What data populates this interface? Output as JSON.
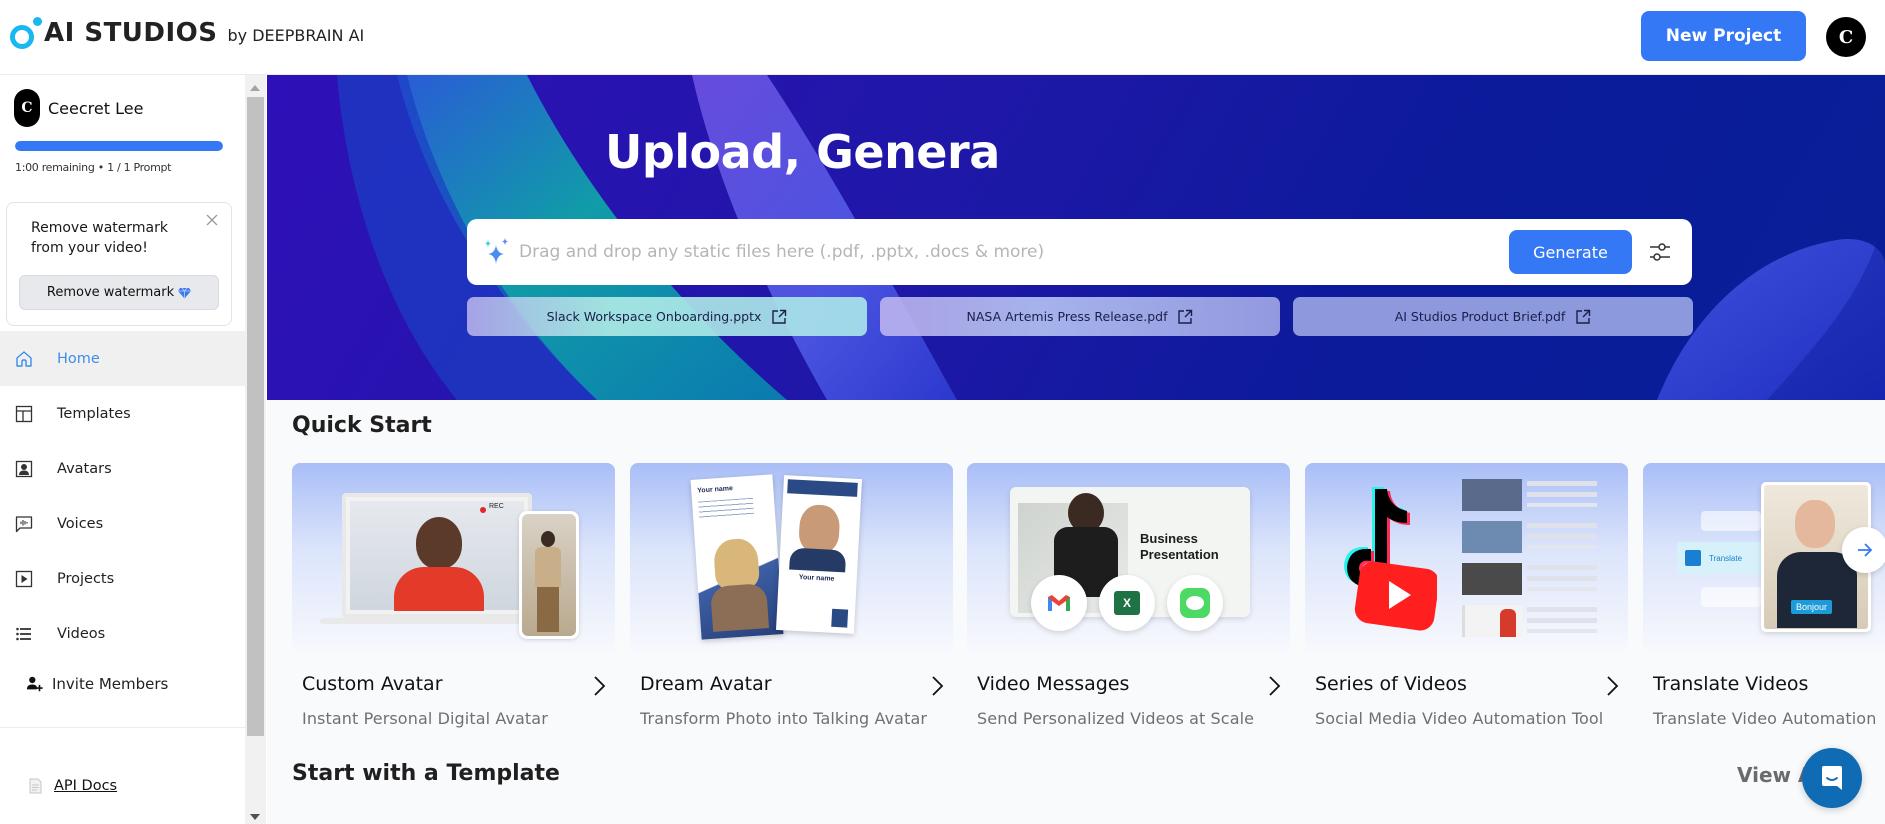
{
  "header": {
    "logo_text": "AI STUDIOS",
    "logo_by": "by DEEPBRAIN AI",
    "new_project_label": "New Project",
    "avatar_initial": "C"
  },
  "sidebar": {
    "user": {
      "initial": "C",
      "name": "Ceecret Lee",
      "usage_fraction": 1.0,
      "usage_text": "1:00 remaining • 1 / 1 Prompt"
    },
    "watermark_card": {
      "message": "Remove watermark from your video!",
      "button_label": "Remove watermark",
      "button_icon": "diamond-icon",
      "close_icon": "close-icon"
    },
    "nav": [
      {
        "label": "Home",
        "icon": "home-icon",
        "active": true
      },
      {
        "label": "Templates",
        "icon": "layout-icon",
        "active": false
      },
      {
        "label": "Avatars",
        "icon": "avatar-icon",
        "active": false
      },
      {
        "label": "Voices",
        "icon": "voice-icon",
        "active": false
      },
      {
        "label": "Projects",
        "icon": "play-icon",
        "active": false
      },
      {
        "label": "Videos",
        "icon": "list-icon",
        "active": false
      }
    ],
    "invite_label": "Invite Members",
    "api_docs_label": "API Docs"
  },
  "hero": {
    "title": "Upload, Genera",
    "search_placeholder": "Drag and drop any static files here (.pdf, .pptx, .docs & more)",
    "generate_label": "Generate",
    "chips": [
      {
        "label": "Slack Workspace Onboarding.pptx",
        "icon": "external-link-icon"
      },
      {
        "label": "NASA Artemis Press Release.pdf",
        "icon": "external-link-icon"
      },
      {
        "label": "AI Studios Product Brief.pdf",
        "icon": "external-link-icon"
      }
    ]
  },
  "quick_start": {
    "title": "Quick Start",
    "cards": [
      {
        "title": "Custom Avatar",
        "subtitle": "Instant Personal Digital Avatar",
        "thumb_rec_label": "REC"
      },
      {
        "title": "Dream Avatar",
        "subtitle": "Transform Photo into Talking Avatar",
        "thumb_label": "Your name"
      },
      {
        "title": "Video Messages",
        "subtitle": "Send Personalized Videos at Scale",
        "thumb_label": "Business Presentation"
      },
      {
        "title": "Series of Videos",
        "subtitle": "Social Media Video Automation Tool"
      },
      {
        "title": "Translate Videos",
        "subtitle": "Translate Video Automation",
        "thumb_translate_label": "Translate",
        "thumb_bubble_label": "Bonjour"
      }
    ]
  },
  "templates": {
    "title": "Start with a Template",
    "view_all_label": "View All"
  }
}
